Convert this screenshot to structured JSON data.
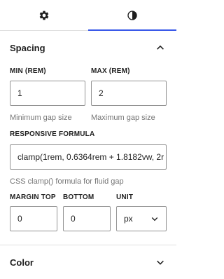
{
  "tabs": [
    {
      "icon": "gear-icon",
      "active": false
    },
    {
      "icon": "half-circle-styles-icon",
      "active": true
    }
  ],
  "spacing": {
    "title": "Spacing",
    "min": {
      "label": "MIN (REM)",
      "value": "1",
      "help": "Minimum gap size"
    },
    "max": {
      "label": "MAX (REM)",
      "value": "2",
      "help": "Maximum gap size"
    },
    "formula": {
      "label": "RESPONSIVE FORMULA",
      "value": "clamp(1rem, 0.6364rem + 1.8182vw, 2r",
      "help": "CSS clamp() formula for fluid gap"
    },
    "margin_top": {
      "label": "MARGIN TOP",
      "value": "0"
    },
    "bottom": {
      "label": "BOTTOM",
      "value": "0"
    },
    "unit": {
      "label": "UNIT",
      "value": "px"
    }
  },
  "color": {
    "title": "Color"
  },
  "colors": {
    "accent": "#3858e9",
    "border": "#949494",
    "muted": "#757575"
  }
}
